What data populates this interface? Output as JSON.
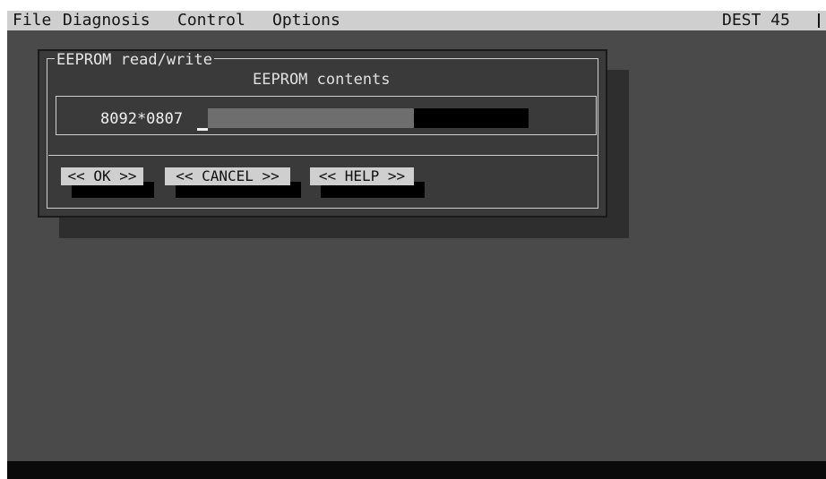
{
  "menubar": {
    "items": [
      "File",
      "Diagnosis",
      "Control",
      "Options"
    ],
    "status": "DEST 45"
  },
  "dialog": {
    "title": "EEPROM read/write",
    "section_label": "EEPROM contents",
    "field_value": "8092*0807",
    "buttons": {
      "ok": "<< OK >>",
      "cancel": "<< CANCEL >>",
      "help": "<< HELP >>"
    }
  }
}
